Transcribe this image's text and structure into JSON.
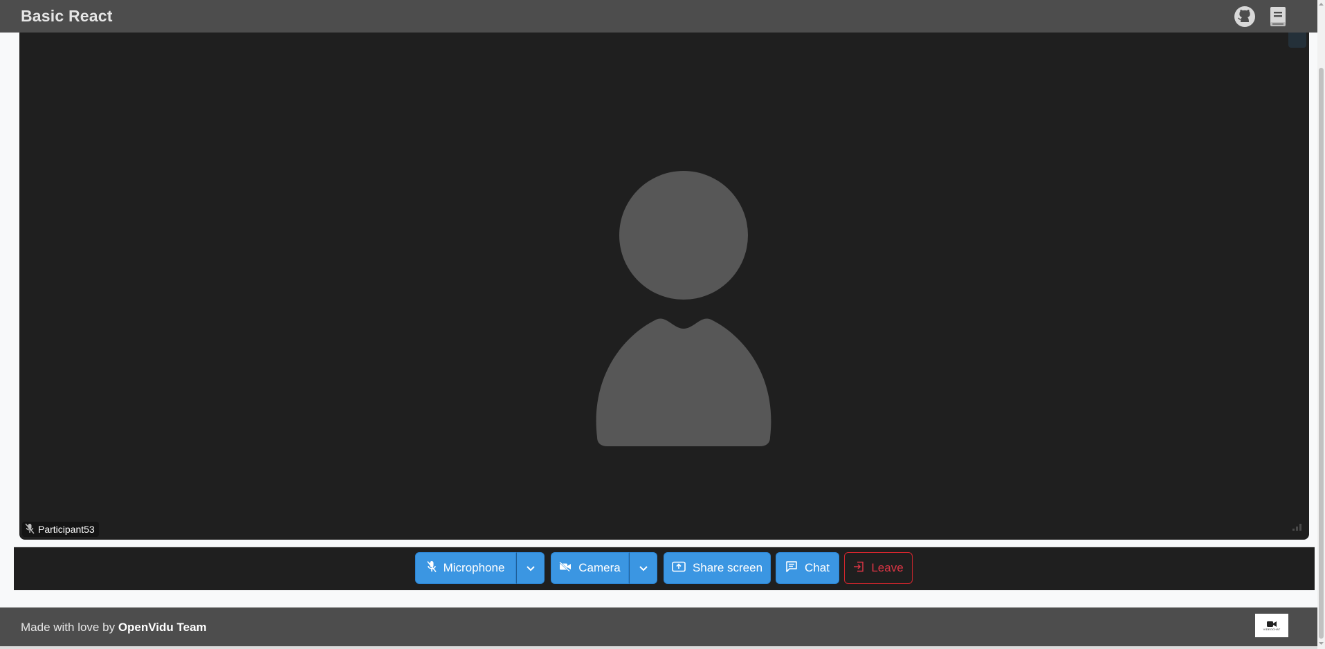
{
  "header": {
    "title": "Basic React",
    "icons": [
      "github-icon",
      "docs-book-icon"
    ]
  },
  "video": {
    "participant_name": "Participant53",
    "muted_icon": "mic-off-icon",
    "placeholder": "person-avatar"
  },
  "toolbar": {
    "microphone_label": "Microphone",
    "camera_label": "Camera",
    "share_screen_label": "Share screen",
    "chat_label": "Chat",
    "leave_label": "Leave"
  },
  "footer": {
    "text_prefix": "Made with love by",
    "team_name": "OpenVidu Team",
    "logo_text": "VIDEOCHAT"
  },
  "colors": {
    "accent_blue": "#3b96e2",
    "danger_red": "#dc3545",
    "bar_gray": "#4d4d4d",
    "video_bg": "#1f1f1f"
  }
}
